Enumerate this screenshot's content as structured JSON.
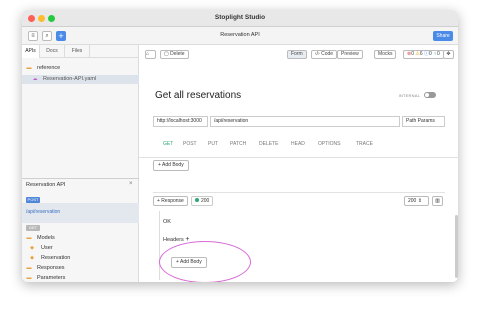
{
  "window": {
    "title": "Stoplight Studio"
  },
  "header": {
    "title": "Reservation API",
    "share_label": "Share",
    "icons": [
      "document-icon",
      "search-icon",
      "add-icon"
    ],
    "add_glyph": "+"
  },
  "sidebar": {
    "tabs": [
      {
        "label": "APIs"
      },
      {
        "label": "Docs"
      },
      {
        "label": "Files"
      }
    ],
    "tree": [
      {
        "icon": "folder-icon",
        "label": "reference"
      },
      {
        "icon": "api-file-icon",
        "label": "Reservation-API.yaml"
      }
    ],
    "panel": {
      "title": "Reservation API",
      "close": "×",
      "method_post": "POST",
      "path": "/api/reservation",
      "method_get": "GET",
      "groups": [
        {
          "icon": "folder-icon",
          "label": "Models"
        },
        {
          "icon": "model-icon",
          "label": "User"
        },
        {
          "icon": "model-icon",
          "label": "Reservation"
        },
        {
          "icon": "folder-icon",
          "label": "Responses"
        },
        {
          "icon": "folder-icon",
          "label": "Parameters"
        }
      ]
    }
  },
  "toolbar": {
    "delete_label": "Delete",
    "form_label": "Form",
    "code_label": "Code",
    "preview_label": "Preview",
    "mocks_label": "Mocks",
    "counts": {
      "errors": "0",
      "warnings": "6",
      "info": "0",
      "hints": "0"
    }
  },
  "operation": {
    "title": "Get all reservations",
    "internal_label": "INTERNAL",
    "server": "http://localhost:3000",
    "path": "/api/reservation",
    "path_params": "Path Params",
    "methods": [
      "GET",
      "POST",
      "PUT",
      "PATCH",
      "DELETE",
      "HEAD",
      "OPTIONS",
      "TRACE"
    ],
    "active_method": "GET",
    "add_body": "+ Add Body"
  },
  "response": {
    "response_button": "+ Response",
    "status": "200",
    "status_select": "200 ⇕",
    "description": "OK",
    "headers_label": "Headers",
    "headers_add": "+",
    "add_body": "+ Add Body"
  },
  "colors": {
    "accent": "#4a8be8",
    "get": "#2ea86f",
    "post": "#4f86d8",
    "highlight": "#d86ad8"
  }
}
